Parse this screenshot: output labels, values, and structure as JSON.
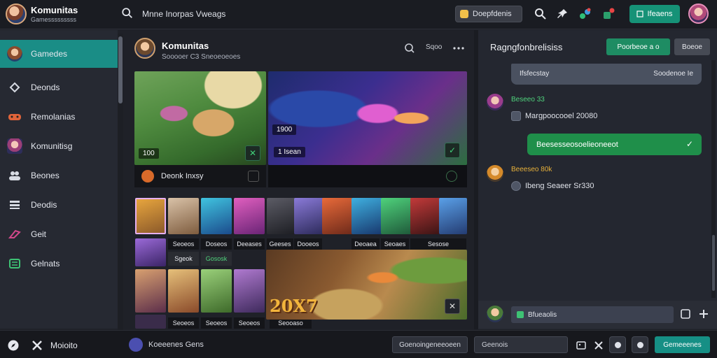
{
  "header": {
    "app_title": "Komunitas",
    "app_subtitle": "Gamesssssssss",
    "search_text": "Mnne Inorpas Vweags",
    "pill_label": "Doepfdenis",
    "action_button_label": "Ifeaens"
  },
  "sidebar": {
    "items": [
      {
        "label": "Gamedes",
        "icon": "game-avatar-icon",
        "active": true
      },
      {
        "label": "Deonds",
        "icon": "diamond-icon",
        "active": false
      },
      {
        "label": "Remolanias",
        "icon": "controller-icon",
        "active": false
      },
      {
        "label": "Komunitisg",
        "icon": "community-avatar-icon",
        "active": false
      },
      {
        "label": "Beones",
        "icon": "people-icon",
        "active": false
      },
      {
        "label": "Deodis",
        "icon": "list-icon",
        "active": false
      },
      {
        "label": "Geit",
        "icon": "joystick-icon",
        "active": false
      },
      {
        "label": "Gelnats",
        "icon": "grid-icon",
        "active": false
      }
    ]
  },
  "main": {
    "title": "Komunitas",
    "subtitle": "Sooooer C3 Sneoeoeoes",
    "header_text": "Sqoo",
    "card1": {
      "tag": "100",
      "caption": "Deonk Inxsy"
    },
    "card2": {
      "tag": "1900",
      "tag2": "1 Isean"
    },
    "tiles_row1_labels": [
      "Seoeos",
      "Doseos",
      "Deeases",
      "Geeses",
      "Dooeos",
      "Deoaea",
      "Seoaes",
      "Sesose"
    ],
    "tiles_row2_labels": [
      "Sgeok",
      "Gososk"
    ],
    "tiles_row3_labels": [
      "Seoeos",
      "Seoeos",
      "Seoeos"
    ],
    "tiles_row3_extra": "Seooaso",
    "card3_text": "20X7"
  },
  "chat": {
    "title": "Ragngfonbrelisiss",
    "btn_primary": "Poorbeoe a o",
    "btn_secondary": "Boeoe",
    "top_message_left": "Ifsfecstay",
    "top_message_right": "Soodenoe Ie",
    "msg1_name": "Beseeo 33",
    "msg1_text": "Margpoocooel 20080",
    "msg2_text": "Beesesseosoelieoneeot",
    "msg3_name": "Beeeseo 80k",
    "msg3_text": "Ibeng Seaeer Sr330",
    "input_placeholder": "Bfueaolis"
  },
  "footer": {
    "left_label": "Moioito",
    "community_label": "Koeeenes Gens",
    "btn1": "Goenoingeneeoeen",
    "search_label": "Geenois",
    "btn_primary": "Gemeeenes"
  },
  "colors": {
    "accent_teal": "#1a8d86",
    "accent_green": "#1f8f4a",
    "background": "#1f2128",
    "name_green": "#4fd27c"
  }
}
